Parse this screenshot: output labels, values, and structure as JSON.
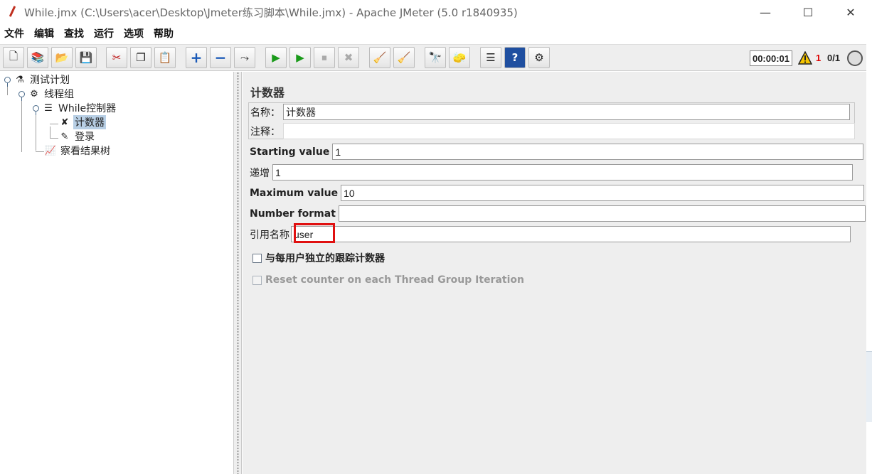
{
  "window": {
    "title": "While.jmx (C:\\Users\\acer\\Desktop\\Jmeter练习脚本\\While.jmx) - Apache JMeter (5.0 r1840935)",
    "minimize": "—",
    "maximize": "☐",
    "close": "✕"
  },
  "menu": [
    "文件",
    "编辑",
    "查找",
    "运行",
    "选项",
    "帮助"
  ],
  "toolbar": {
    "buttons": [
      {
        "name": "new-icon",
        "glyph": "🗋"
      },
      {
        "name": "templates-icon",
        "glyph": "📚"
      },
      {
        "name": "open-icon",
        "glyph": "📂"
      },
      {
        "name": "save-icon",
        "glyph": "💾"
      },
      {
        "name": "cut-icon",
        "glyph": "✂"
      },
      {
        "name": "copy-icon",
        "glyph": "❐"
      },
      {
        "name": "paste-icon",
        "glyph": "📋"
      },
      {
        "name": "expand-icon",
        "glyph": "+"
      },
      {
        "name": "collapse-icon",
        "glyph": "−"
      },
      {
        "name": "toggle-icon",
        "glyph": "⤳"
      },
      {
        "name": "start-icon",
        "glyph": "▶"
      },
      {
        "name": "start-no-pause-icon",
        "glyph": "▶"
      },
      {
        "name": "stop-icon",
        "glyph": "⏹"
      },
      {
        "name": "shutdown-icon",
        "glyph": "✖"
      },
      {
        "name": "clear-icon",
        "glyph": "🧹"
      },
      {
        "name": "clear-all-icon",
        "glyph": "🧹"
      },
      {
        "name": "search-icon",
        "glyph": "🔭"
      },
      {
        "name": "reset-search-icon",
        "glyph": "🧽"
      },
      {
        "name": "function-helper-icon",
        "glyph": "☰"
      },
      {
        "name": "help-icon",
        "glyph": "?"
      },
      {
        "name": "logger-icon",
        "glyph": "⚙"
      }
    ],
    "timer": "00:00:01",
    "warning_count": "1",
    "threads": "0/1"
  },
  "tree": {
    "test_plan": "测试计划",
    "thread_group": "线程组",
    "while_controller": "While控制器",
    "counter": "计数器",
    "login": "登录",
    "result_tree": "察看结果树"
  },
  "panel": {
    "title": "计数器",
    "name_label": "名称：",
    "name_value": "计数器",
    "comment_label": "注释：",
    "comment_value": "",
    "start_label": "Starting value",
    "start_value": "1",
    "increment_label": "递增",
    "increment_value": "1",
    "max_label": "Maximum value",
    "max_value": "10",
    "format_label": "Number format",
    "format_value": "",
    "ref_label": "引用名称",
    "ref_value": "user",
    "per_user_label": "与每用户独立的跟踪计数器",
    "per_user_checked": false,
    "reset_label": "Reset counter on each Thread Group Iteration",
    "reset_checked": false
  }
}
